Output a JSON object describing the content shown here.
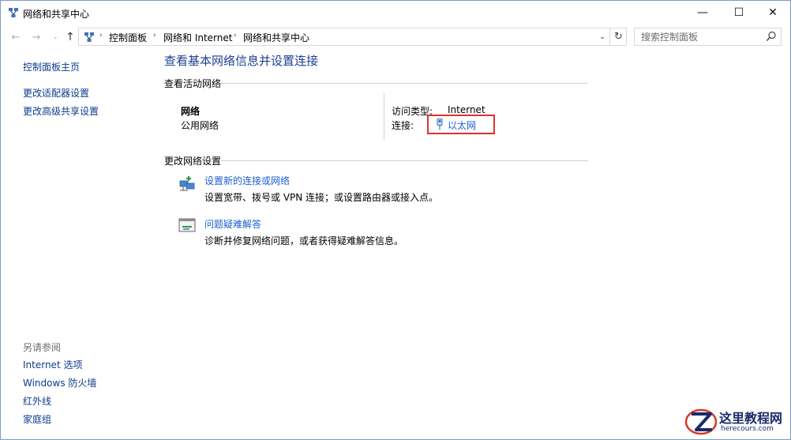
{
  "window": {
    "title": "网络和共享中心",
    "icon": "network-icon"
  },
  "titlebar_buttons": {
    "minimize": "—",
    "maximize": "☐",
    "close": "✕"
  },
  "navigation": {
    "back": "←",
    "forward": "→",
    "recent": "⌄",
    "up": "↑"
  },
  "address": {
    "breadcrumbs": [
      "控制面板",
      "网络和 Internet",
      "网络和共享中心"
    ],
    "separator": "›",
    "dropdown": "⌄",
    "refresh": "↻"
  },
  "search": {
    "placeholder": "搜索控制面板",
    "icon": "search-icon"
  },
  "left_pane": {
    "links": [
      "控制面板主页",
      "更改适配器设置",
      "更改高级共享设置"
    ],
    "see_also_title": "另请参阅",
    "see_also_links": [
      "Internet 选项",
      "Windows 防火墙",
      "红外线",
      "家庭组"
    ]
  },
  "main": {
    "page_title": "查看基本网络信息并设置连接",
    "active_networks_heading": "查看活动网络",
    "network": {
      "name": "网络",
      "category": "公用网络",
      "access_type_label": "访问类型:",
      "access_type_value": "Internet",
      "connection_label": "连接:",
      "connection_value": "以太网"
    },
    "change_settings_heading": "更改网络设置",
    "tasks": [
      {
        "title": "设置新的连接或网络",
        "description": "设置宽带、拨号或 VPN 连接；或设置路由器或接入点。",
        "icon": "new-connection-icon"
      },
      {
        "title": "问题疑难解答",
        "description": "诊断并修复网络问题，或者获得疑难解答信息。",
        "icon": "troubleshoot-icon"
      }
    ]
  },
  "watermark": {
    "title": "这里教程网",
    "url": "herecours.com"
  },
  "colors": {
    "link": "#1d5fd1",
    "left_link": "#0c3b8f",
    "title_blue": "#1e3f93",
    "highlight_border": "#e03030"
  }
}
